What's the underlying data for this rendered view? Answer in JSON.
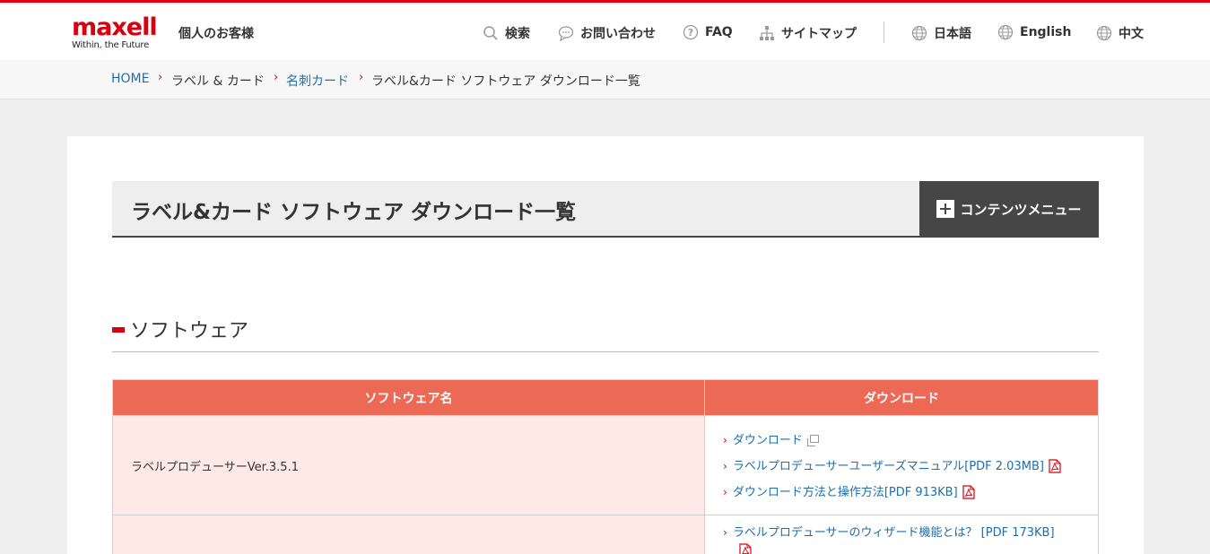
{
  "header": {
    "logo_word": "maxell",
    "logo_tagline_a": "Within",
    "logo_tagline_b": "the Future",
    "audience": "個人のお客様",
    "nav": {
      "search": "検索",
      "contact": "お問い合わせ",
      "faq": "FAQ",
      "sitemap": "サイトマップ",
      "japanese": "日本語",
      "english": "English",
      "chinese": "中文"
    }
  },
  "breadcrumb": {
    "home": "HOME",
    "label_card": "ラベル & カード",
    "business_card": "名刺カード",
    "current": "ラベル&カード ソフトウェア ダウンロード一覧"
  },
  "page": {
    "title": "ラベル&カード ソフトウェア ダウンロード一覧",
    "menu_button": "コンテンツメニュー",
    "section_title": "ソフトウェア"
  },
  "table": {
    "headers": [
      "ソフトウェア名",
      "ダウンロード"
    ],
    "rows": [
      {
        "name": "ラベルプロデューサーVer.3.5.1",
        "links": [
          {
            "label": "ダウンロード",
            "icon": "external-window-icon"
          },
          {
            "label": "ラベルプロデューサーユーザーズマニュアル[PDF 2.03MB]",
            "icon": "pdf-icon"
          },
          {
            "label": "ダウンロード方法と操作方法[PDF 913KB]",
            "icon": "pdf-icon"
          }
        ]
      },
      {
        "name": "",
        "links": [
          {
            "label": "ラベルプロデューサーのウィザード機能とは？ [PDF 173KB]",
            "icon": "pdf-icon"
          }
        ]
      }
    ]
  },
  "colors": {
    "brand_red": "#d7000f",
    "table_header": "#ec6a55",
    "name_cell_bg": "#fde9e6",
    "link_blue": "#1f6ea8",
    "menu_button_bg": "#464646"
  }
}
